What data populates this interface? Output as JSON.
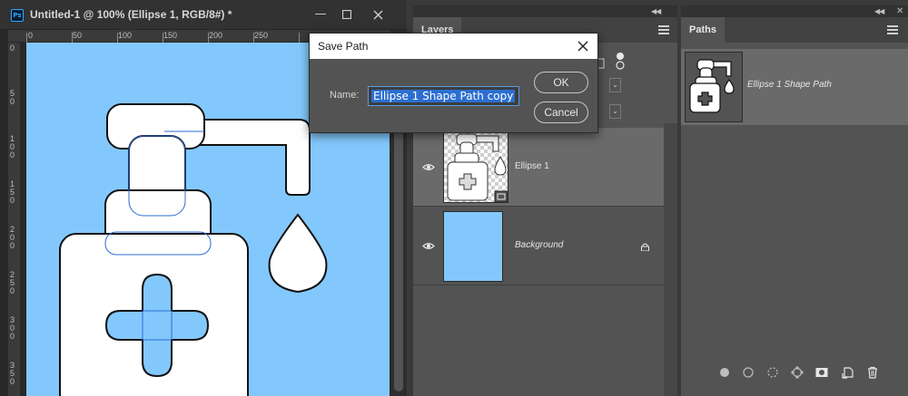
{
  "document": {
    "title": "Untitled-1 @ 100% (Ellipse 1, RGB/8#) *",
    "app_icon": "ps-icon",
    "ruler_top_labels": [
      "0",
      "50",
      "100",
      "150",
      "200",
      "250"
    ],
    "ruler_left_labels": [
      "0",
      "5 0",
      "1 0 0",
      "1 5 0",
      "2 0 0",
      "2 5 0",
      "3 0 0",
      "3 5 0"
    ],
    "canvas_color": "#83c8fc"
  },
  "layers_panel": {
    "tab_label": "Layers",
    "rows": [
      {
        "name": "Ellipse 1",
        "visible": true,
        "selected": true
      },
      {
        "name": "Background",
        "visible": true,
        "selected": false,
        "locked": true
      }
    ]
  },
  "paths_panel": {
    "tab_label": "Paths",
    "items": [
      {
        "name": "Ellipse 1 Shape Path",
        "selected": true
      }
    ],
    "footer_icons": [
      "fill-path-icon",
      "stroke-path-icon",
      "load-selection-icon",
      "make-work-path-icon",
      "add-mask-icon",
      "new-path-icon",
      "delete-path-icon"
    ]
  },
  "dialog": {
    "title": "Save Path",
    "name_label": "Name:",
    "name_value": "Ellipse 1 Shape Path copy",
    "ok_label": "OK",
    "cancel_label": "Cancel"
  },
  "colors": {
    "canvas": "#83c8fc",
    "selection": "#2c6fd1",
    "panel": "#535353"
  }
}
